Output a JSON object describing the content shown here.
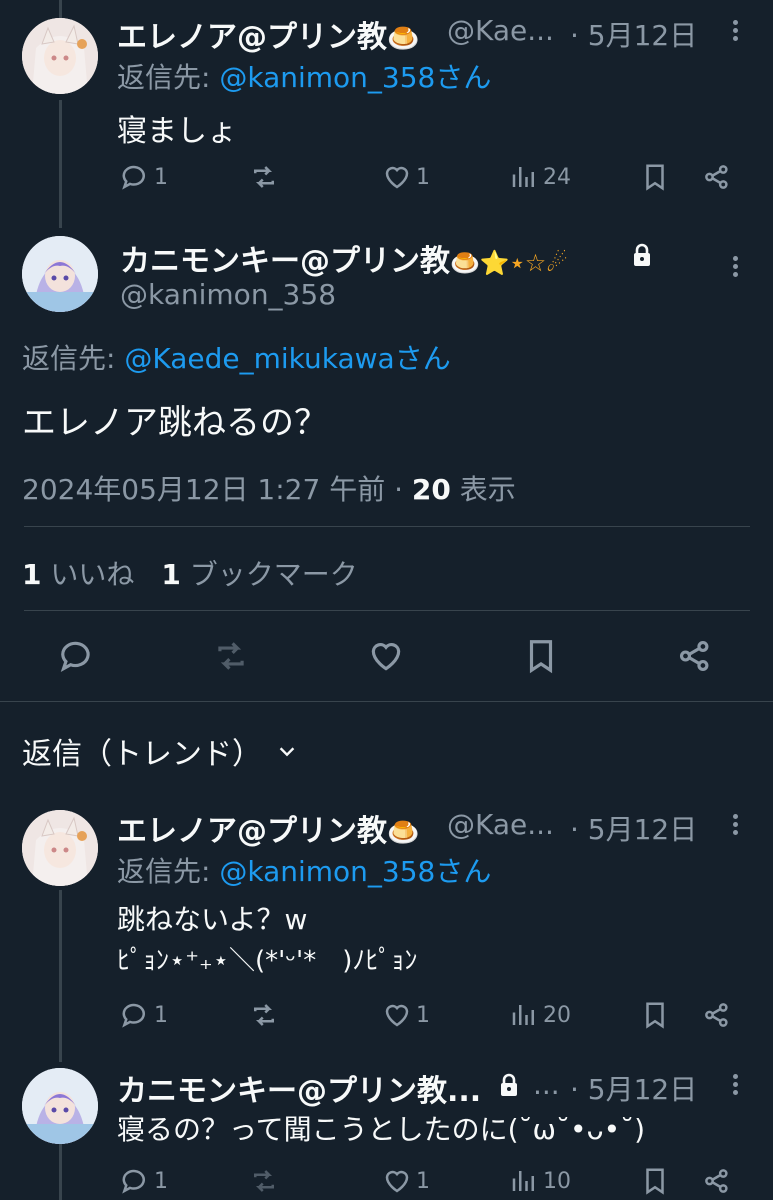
{
  "tweet1": {
    "name": "エレノア@プリン教",
    "emoji": "🍮",
    "handle": "@Kae...",
    "date": "· 5月12日",
    "reply_prefix": "返信先: ",
    "reply_to": "@kanimon_358さん",
    "text": "寝ましょ",
    "replies": "1",
    "likes": "1",
    "views": "24"
  },
  "main": {
    "name": "カニモンキー@プリン教",
    "emoji": "🍮⭐⋆☆☄",
    "handle": "@kanimon_358",
    "reply_prefix": "返信先: ",
    "reply_to": "@Kaede_mikukawaさん",
    "text": "エレノア跳ねるの？",
    "meta_date": "2024年05月12日 1:27 午前 · ",
    "meta_views": "20",
    "meta_views_label": " 表示",
    "like_count": "1",
    "like_label": "いいね",
    "bookmark_count": "1",
    "bookmark_label": "ブックマーク"
  },
  "sort_label": "返信（トレンド）",
  "tweet2": {
    "name": "エレノア@プリン教",
    "emoji": "🍮",
    "handle": "@Kae...",
    "date": "· 5月12日",
    "reply_prefix": "返信先: ",
    "reply_to": "@kanimon_358さん",
    "line1": "跳ねないよ？w",
    "line2": "ﾋﾟｮﾝ⋆⁺₊⋆＼(*'ᵕ'*　)ﾉﾋﾟｮﾝ",
    "replies": "1",
    "likes": "1",
    "views": "20"
  },
  "tweet3": {
    "name": "カニモンキー@プリン教...",
    "handle_trunc": "...",
    "date": "· 5月12日",
    "text": "寝るの？って聞こうとしたのに(˘ω˘•ᴗ•˘)",
    "replies": "1",
    "likes": "1",
    "views": "10"
  },
  "icons": {
    "reply": "reply-icon",
    "retweet": "retweet-icon",
    "like": "heart-icon",
    "views": "views-icon",
    "bookmark": "bookmark-icon",
    "share": "share-icon",
    "lock": "lock-icon",
    "more": "more-icon",
    "chevron": "chevron-down-icon"
  },
  "colors": {
    "background": "#15202b",
    "link": "#1d9bf0",
    "muted": "#8b98a5",
    "text": "#f7f9f9"
  }
}
